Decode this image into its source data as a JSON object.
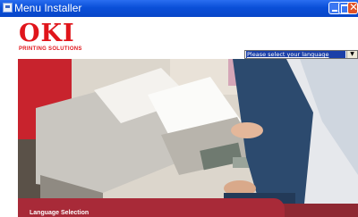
{
  "window": {
    "title": "Menu Installer",
    "controls": {
      "minimize_icon": "minimize-icon",
      "maximize_icon": "maximize-icon",
      "close_icon": "close-icon"
    }
  },
  "logo": {
    "text": "OKI",
    "subtitle": "PRINTING SOLUTIONS"
  },
  "language": {
    "selected": "Please select your language"
  },
  "footer": {
    "label": "Language Selection"
  },
  "colors": {
    "brand_red": "#e0151b",
    "footer_red": "#a82a38",
    "titlebar_blue": "#0a4fd8"
  }
}
